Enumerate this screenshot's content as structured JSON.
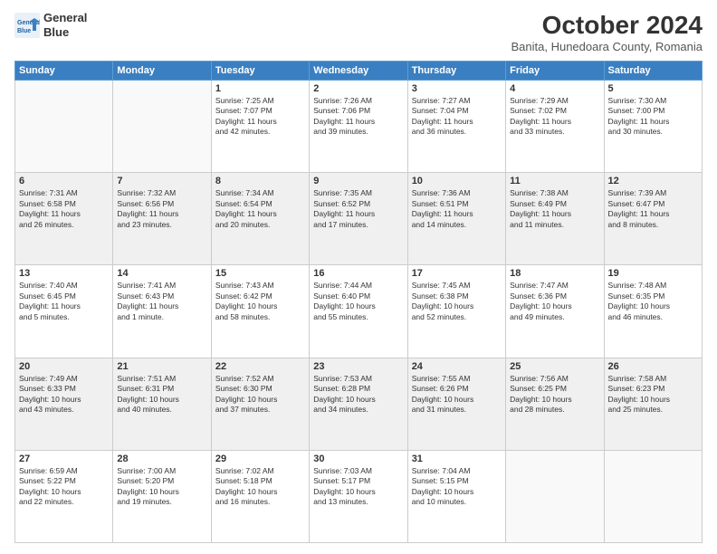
{
  "header": {
    "logo_line1": "General",
    "logo_line2": "Blue",
    "title": "October 2024",
    "subtitle": "Banita, Hunedoara County, Romania"
  },
  "weekdays": [
    "Sunday",
    "Monday",
    "Tuesday",
    "Wednesday",
    "Thursday",
    "Friday",
    "Saturday"
  ],
  "weeks": [
    [
      {
        "day": "",
        "info": ""
      },
      {
        "day": "",
        "info": ""
      },
      {
        "day": "1",
        "info": "Sunrise: 7:25 AM\nSunset: 7:07 PM\nDaylight: 11 hours\nand 42 minutes."
      },
      {
        "day": "2",
        "info": "Sunrise: 7:26 AM\nSunset: 7:06 PM\nDaylight: 11 hours\nand 39 minutes."
      },
      {
        "day": "3",
        "info": "Sunrise: 7:27 AM\nSunset: 7:04 PM\nDaylight: 11 hours\nand 36 minutes."
      },
      {
        "day": "4",
        "info": "Sunrise: 7:29 AM\nSunset: 7:02 PM\nDaylight: 11 hours\nand 33 minutes."
      },
      {
        "day": "5",
        "info": "Sunrise: 7:30 AM\nSunset: 7:00 PM\nDaylight: 11 hours\nand 30 minutes."
      }
    ],
    [
      {
        "day": "6",
        "info": "Sunrise: 7:31 AM\nSunset: 6:58 PM\nDaylight: 11 hours\nand 26 minutes."
      },
      {
        "day": "7",
        "info": "Sunrise: 7:32 AM\nSunset: 6:56 PM\nDaylight: 11 hours\nand 23 minutes."
      },
      {
        "day": "8",
        "info": "Sunrise: 7:34 AM\nSunset: 6:54 PM\nDaylight: 11 hours\nand 20 minutes."
      },
      {
        "day": "9",
        "info": "Sunrise: 7:35 AM\nSunset: 6:52 PM\nDaylight: 11 hours\nand 17 minutes."
      },
      {
        "day": "10",
        "info": "Sunrise: 7:36 AM\nSunset: 6:51 PM\nDaylight: 11 hours\nand 14 minutes."
      },
      {
        "day": "11",
        "info": "Sunrise: 7:38 AM\nSunset: 6:49 PM\nDaylight: 11 hours\nand 11 minutes."
      },
      {
        "day": "12",
        "info": "Sunrise: 7:39 AM\nSunset: 6:47 PM\nDaylight: 11 hours\nand 8 minutes."
      }
    ],
    [
      {
        "day": "13",
        "info": "Sunrise: 7:40 AM\nSunset: 6:45 PM\nDaylight: 11 hours\nand 5 minutes."
      },
      {
        "day": "14",
        "info": "Sunrise: 7:41 AM\nSunset: 6:43 PM\nDaylight: 11 hours\nand 1 minute."
      },
      {
        "day": "15",
        "info": "Sunrise: 7:43 AM\nSunset: 6:42 PM\nDaylight: 10 hours\nand 58 minutes."
      },
      {
        "day": "16",
        "info": "Sunrise: 7:44 AM\nSunset: 6:40 PM\nDaylight: 10 hours\nand 55 minutes."
      },
      {
        "day": "17",
        "info": "Sunrise: 7:45 AM\nSunset: 6:38 PM\nDaylight: 10 hours\nand 52 minutes."
      },
      {
        "day": "18",
        "info": "Sunrise: 7:47 AM\nSunset: 6:36 PM\nDaylight: 10 hours\nand 49 minutes."
      },
      {
        "day": "19",
        "info": "Sunrise: 7:48 AM\nSunset: 6:35 PM\nDaylight: 10 hours\nand 46 minutes."
      }
    ],
    [
      {
        "day": "20",
        "info": "Sunrise: 7:49 AM\nSunset: 6:33 PM\nDaylight: 10 hours\nand 43 minutes."
      },
      {
        "day": "21",
        "info": "Sunrise: 7:51 AM\nSunset: 6:31 PM\nDaylight: 10 hours\nand 40 minutes."
      },
      {
        "day": "22",
        "info": "Sunrise: 7:52 AM\nSunset: 6:30 PM\nDaylight: 10 hours\nand 37 minutes."
      },
      {
        "day": "23",
        "info": "Sunrise: 7:53 AM\nSunset: 6:28 PM\nDaylight: 10 hours\nand 34 minutes."
      },
      {
        "day": "24",
        "info": "Sunrise: 7:55 AM\nSunset: 6:26 PM\nDaylight: 10 hours\nand 31 minutes."
      },
      {
        "day": "25",
        "info": "Sunrise: 7:56 AM\nSunset: 6:25 PM\nDaylight: 10 hours\nand 28 minutes."
      },
      {
        "day": "26",
        "info": "Sunrise: 7:58 AM\nSunset: 6:23 PM\nDaylight: 10 hours\nand 25 minutes."
      }
    ],
    [
      {
        "day": "27",
        "info": "Sunrise: 6:59 AM\nSunset: 5:22 PM\nDaylight: 10 hours\nand 22 minutes."
      },
      {
        "day": "28",
        "info": "Sunrise: 7:00 AM\nSunset: 5:20 PM\nDaylight: 10 hours\nand 19 minutes."
      },
      {
        "day": "29",
        "info": "Sunrise: 7:02 AM\nSunset: 5:18 PM\nDaylight: 10 hours\nand 16 minutes."
      },
      {
        "day": "30",
        "info": "Sunrise: 7:03 AM\nSunset: 5:17 PM\nDaylight: 10 hours\nand 13 minutes."
      },
      {
        "day": "31",
        "info": "Sunrise: 7:04 AM\nSunset: 5:15 PM\nDaylight: 10 hours\nand 10 minutes."
      },
      {
        "day": "",
        "info": ""
      },
      {
        "day": "",
        "info": ""
      }
    ]
  ]
}
